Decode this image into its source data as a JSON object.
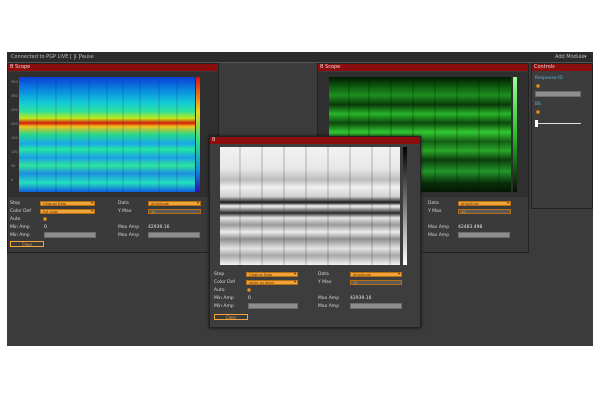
{
  "topbar": {
    "title": "Connected to PGP LIVE [ 1 ]",
    "pause_label": "Pause",
    "menu_label": "Add Module"
  },
  "b_scope_left": {
    "title": "B Scope",
    "y_ticks": [
      "350",
      "300",
      "250",
      "200",
      "150",
      "100",
      "50",
      "0"
    ],
    "controls": {
      "step_label": "Step",
      "step_value": "Original Data",
      "data_label": "Data",
      "data_value": "Amplitude",
      "color_def_label": "Color Def",
      "color_def_value": "full color",
      "y_max_label": "Y Max",
      "y_max_value": "10",
      "auto_label": "Auto",
      "min_amp_label": "Min Amp",
      "min_amp_value": "0",
      "max_amp_label": "Max Amp",
      "max_amp_value": "42939.16",
      "min_amp2_label": "Min Amp",
      "max_amp2_label": "Max Amp",
      "clear_label": "Clear"
    }
  },
  "b_scope_right": {
    "title": "B Scope",
    "controls": {
      "data_label": "Data",
      "data_value": "Amplitude",
      "y_max_label": "Y Max",
      "y_max_value": "10",
      "max_amp_label": "Max Amp",
      "max_amp_value": "42483.498",
      "max_amp2_label": "Max Amp"
    }
  },
  "controls_panel": {
    "title": "Controls",
    "section1": "Response ID",
    "section2": "BS"
  },
  "floating_scope": {
    "title": "B",
    "controls": {
      "step_label": "Step",
      "step_value": "Original Data",
      "data_label": "Data",
      "data_value": "Amplitude",
      "color_def_label": "Color Def",
      "color_def_value": "white on black",
      "y_max_label": "Y Max",
      "y_max_value": "10",
      "auto_label": "Auto",
      "min_amp_label": "Min Amp",
      "min_amp_value": "0",
      "max_amp_label": "Max Amp",
      "max_amp_value": "42939.16",
      "min_amp2_label": "Min Amp",
      "max_amp2_label": "Max Amp",
      "clear_label": "Clear"
    }
  },
  "colors": {
    "header_red": "#8b0d0d",
    "accent_orange": "#f2a43a",
    "panel_bg": "#3a3a3a",
    "title_teal": "#5fb8d8"
  }
}
